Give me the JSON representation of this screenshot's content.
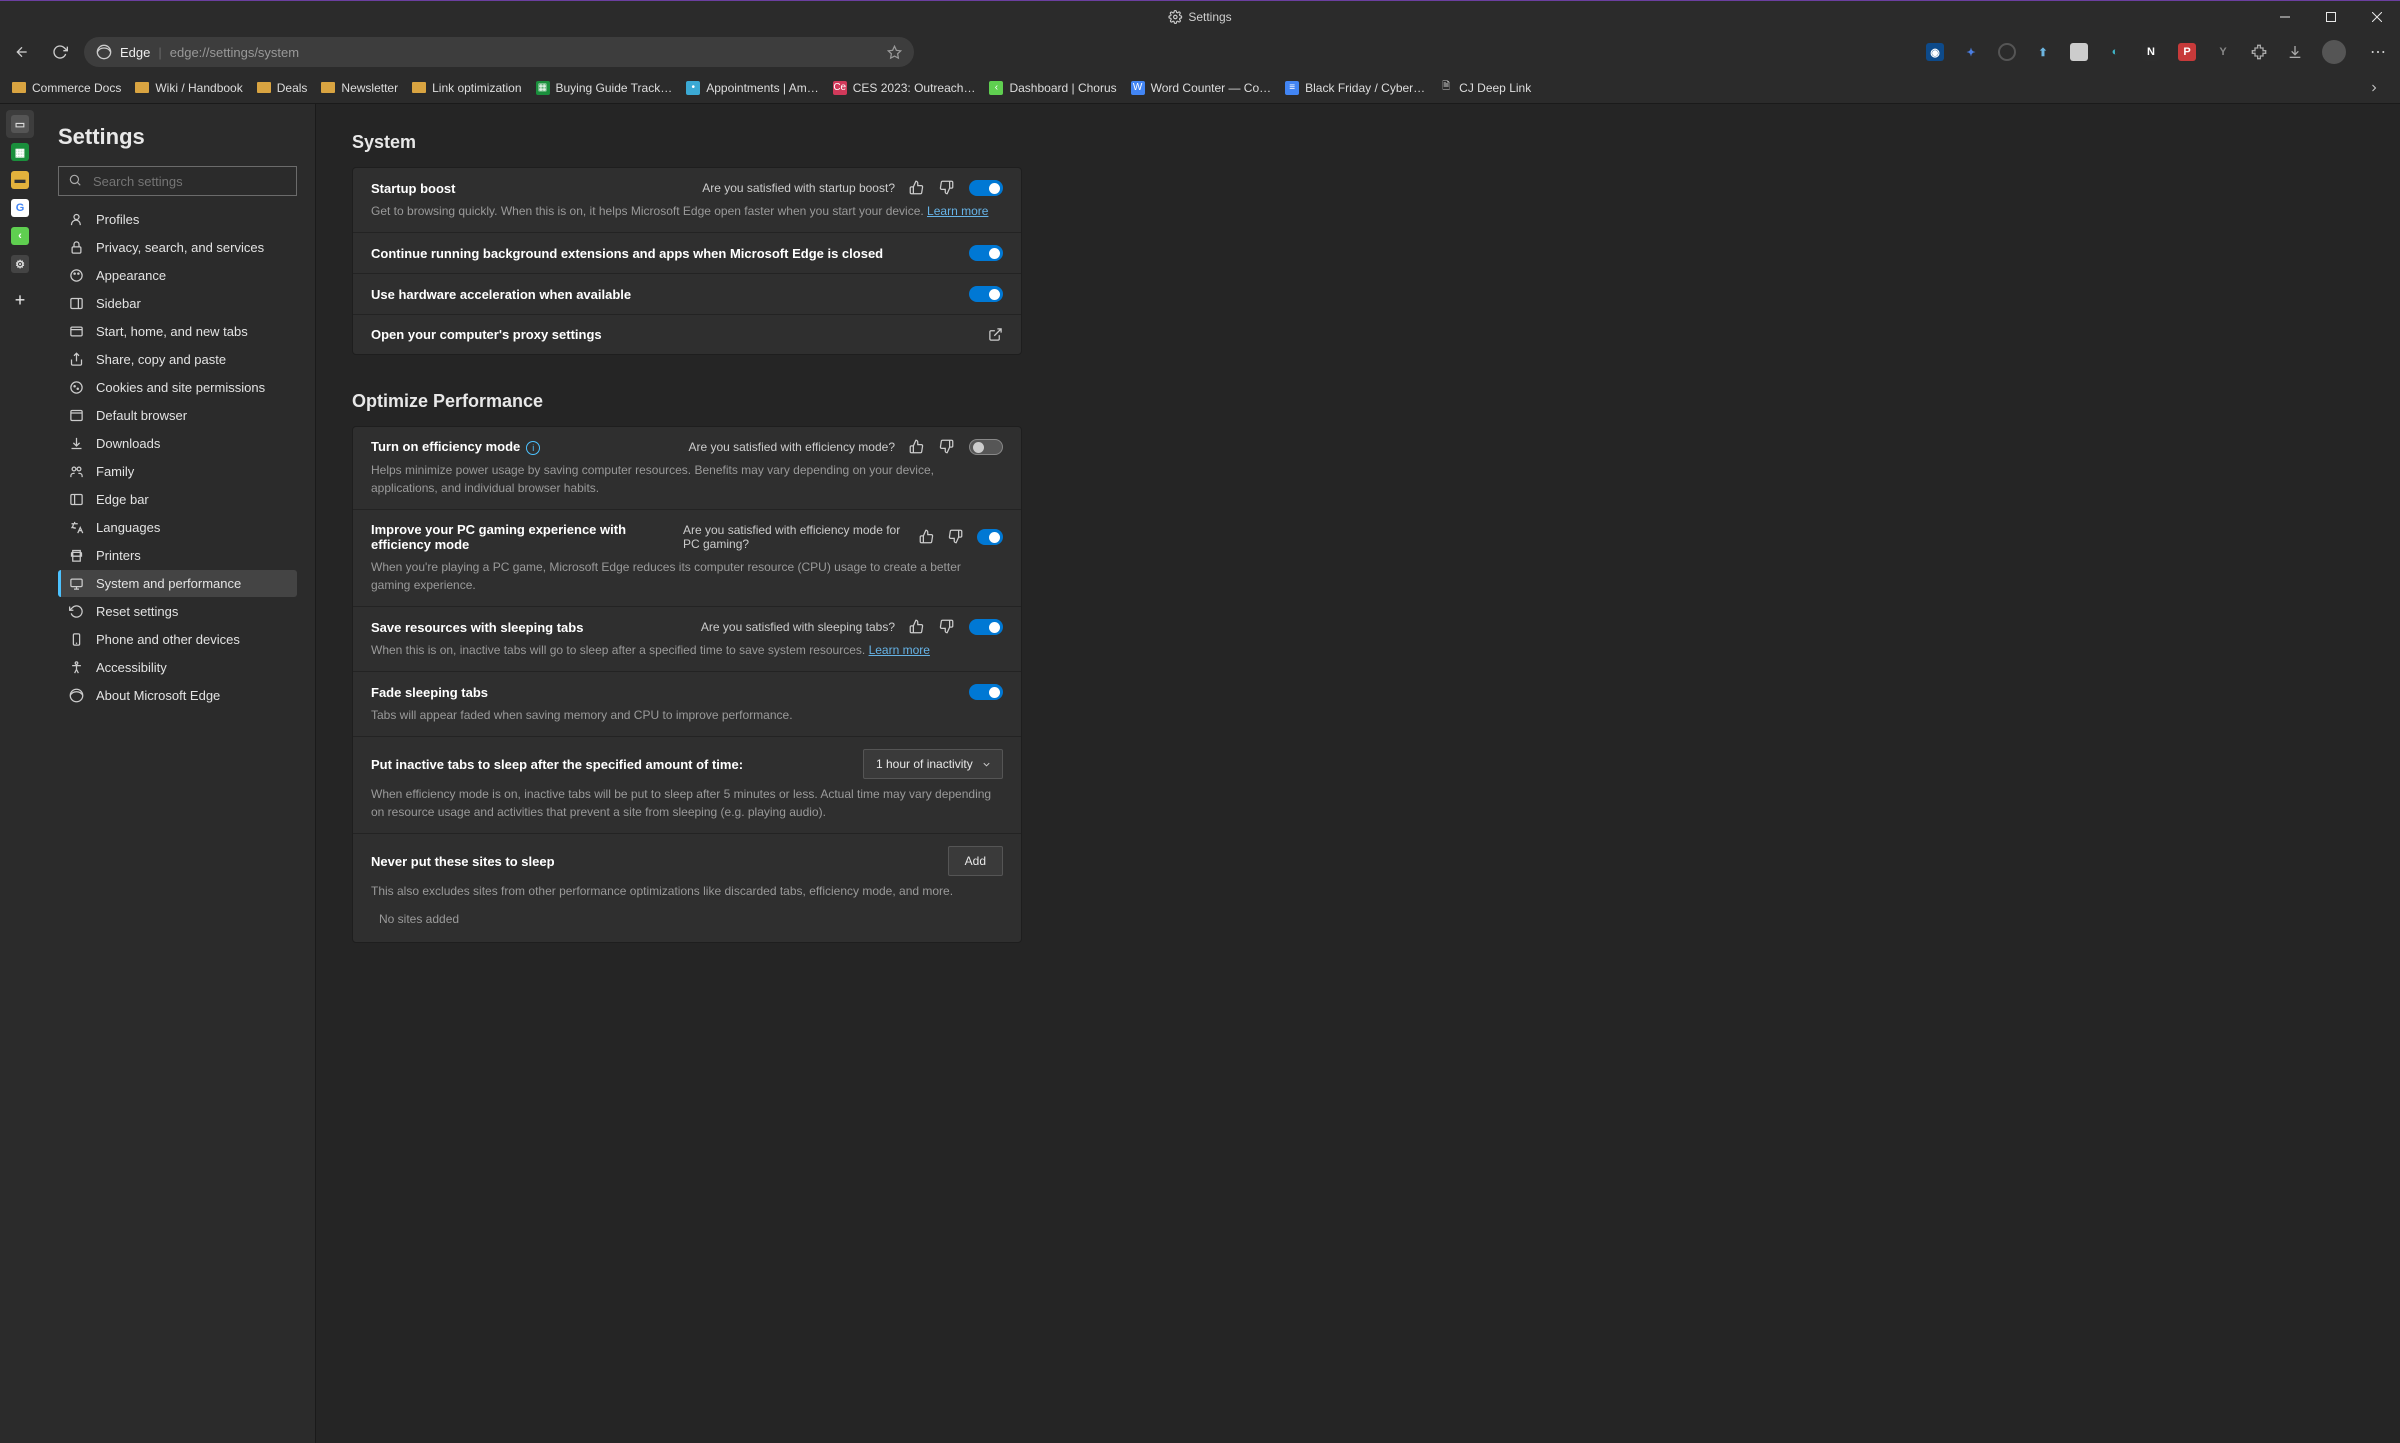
{
  "titlebar": {
    "title": "Settings"
  },
  "address": {
    "app": "Edge",
    "url": "edge://settings/system"
  },
  "bookmarks": [
    {
      "type": "folder",
      "label": "Commerce Docs"
    },
    {
      "type": "folder",
      "label": "Wiki / Handbook"
    },
    {
      "type": "folder",
      "label": "Deals"
    },
    {
      "type": "folder",
      "label": "Newsletter"
    },
    {
      "type": "folder",
      "label": "Link optimization"
    },
    {
      "type": "sheet",
      "label": "Buying Guide Track…"
    },
    {
      "type": "app",
      "label": "Appointments | Am…",
      "color": "#3ba9d4"
    },
    {
      "type": "app",
      "label": "CES 2023: Outreach…",
      "color": "#d1395a",
      "badge": "Ce"
    },
    {
      "type": "app",
      "label": "Dashboard | Chorus",
      "color": "#5fcf50",
      "badge": "‹"
    },
    {
      "type": "doc",
      "label": "Word Counter — Co…",
      "color": "#4285f4",
      "badge": "W"
    },
    {
      "type": "gdoc",
      "label": "Black Friday / Cyber…"
    },
    {
      "type": "file",
      "label": "CJ Deep Link"
    }
  ],
  "vtabs": [
    {
      "bg": "#555",
      "fg": "#ddd",
      "glyph": "▭",
      "active": true
    },
    {
      "bg": "#1a8f3c",
      "fg": "#fff",
      "glyph": "▦"
    },
    {
      "bg": "#e3b23c",
      "fg": "#333",
      "glyph": "▬"
    },
    {
      "bg": "#fff",
      "fg": "#4285f4",
      "glyph": "G"
    },
    {
      "bg": "#5fcf50",
      "fg": "#fff",
      "glyph": "‹"
    },
    {
      "bg": "#444",
      "fg": "#ddd",
      "glyph": "⚙"
    }
  ],
  "sidebar": {
    "heading": "Settings",
    "search_placeholder": "Search settings",
    "items": [
      {
        "icon": "person",
        "label": "Profiles"
      },
      {
        "icon": "lock",
        "label": "Privacy, search, and services"
      },
      {
        "icon": "palette",
        "label": "Appearance"
      },
      {
        "icon": "panel",
        "label": "Sidebar"
      },
      {
        "icon": "tab",
        "label": "Start, home, and new tabs"
      },
      {
        "icon": "share",
        "label": "Share, copy and paste"
      },
      {
        "icon": "cookie",
        "label": "Cookies and site permissions"
      },
      {
        "icon": "browser",
        "label": "Default browser"
      },
      {
        "icon": "download",
        "label": "Downloads"
      },
      {
        "icon": "family",
        "label": "Family"
      },
      {
        "icon": "edgebar",
        "label": "Edge bar"
      },
      {
        "icon": "lang",
        "label": "Languages"
      },
      {
        "icon": "printer",
        "label": "Printers"
      },
      {
        "icon": "system",
        "label": "System and performance",
        "selected": true
      },
      {
        "icon": "reset",
        "label": "Reset settings"
      },
      {
        "icon": "phone",
        "label": "Phone and other devices"
      },
      {
        "icon": "a11y",
        "label": "Accessibility"
      },
      {
        "icon": "about",
        "label": "About Microsoft Edge"
      }
    ]
  },
  "sections": {
    "system": {
      "heading": "System",
      "rows": {
        "startup": {
          "title": "Startup boost",
          "feedback": "Are you satisfied with startup boost?",
          "desc_a": "Get to browsing quickly. When this is on, it helps Microsoft Edge open faster when you start your device. ",
          "learn": "Learn more",
          "on": true
        },
        "background": {
          "title": "Continue running background extensions and apps when Microsoft Edge is closed",
          "on": true
        },
        "hw": {
          "title": "Use hardware acceleration when available",
          "on": true
        },
        "proxy": {
          "title": "Open your computer's proxy settings"
        }
      }
    },
    "perf": {
      "heading": "Optimize Performance",
      "rows": {
        "efficiency": {
          "title": "Turn on efficiency mode",
          "feedback": "Are you satisfied with efficiency mode?",
          "desc": "Helps minimize power usage by saving computer resources. Benefits may vary depending on your device, applications, and individual browser habits.",
          "on": false
        },
        "gaming": {
          "title": "Improve your PC gaming experience with efficiency mode",
          "feedback": "Are you satisfied with efficiency mode for PC gaming?",
          "desc": "When you're playing a PC game, Microsoft Edge reduces its computer resource (CPU) usage to create a better gaming experience.",
          "on": true
        },
        "sleeping": {
          "title": "Save resources with sleeping tabs",
          "feedback": "Are you satisfied with sleeping tabs?",
          "desc_a": "When this is on, inactive tabs will go to sleep after a specified time to save system resources. ",
          "learn": "Learn more",
          "on": true
        },
        "fade": {
          "title": "Fade sleeping tabs",
          "desc": "Tabs will appear faded when saving memory and CPU to improve performance.",
          "on": true
        },
        "timer": {
          "title": "Put inactive tabs to sleep after the specified amount of time:",
          "value": "1 hour of inactivity",
          "desc": "When efficiency mode is on, inactive tabs will be put to sleep after 5 minutes or less. Actual time may vary depending on resource usage and activities that prevent a site from sleeping (e.g. playing audio)."
        },
        "never": {
          "title": "Never put these sites to sleep",
          "btn": "Add",
          "desc": "This also excludes sites from other performance optimizations like discarded tabs, efficiency mode, and more.",
          "empty": "No sites added"
        }
      }
    }
  }
}
